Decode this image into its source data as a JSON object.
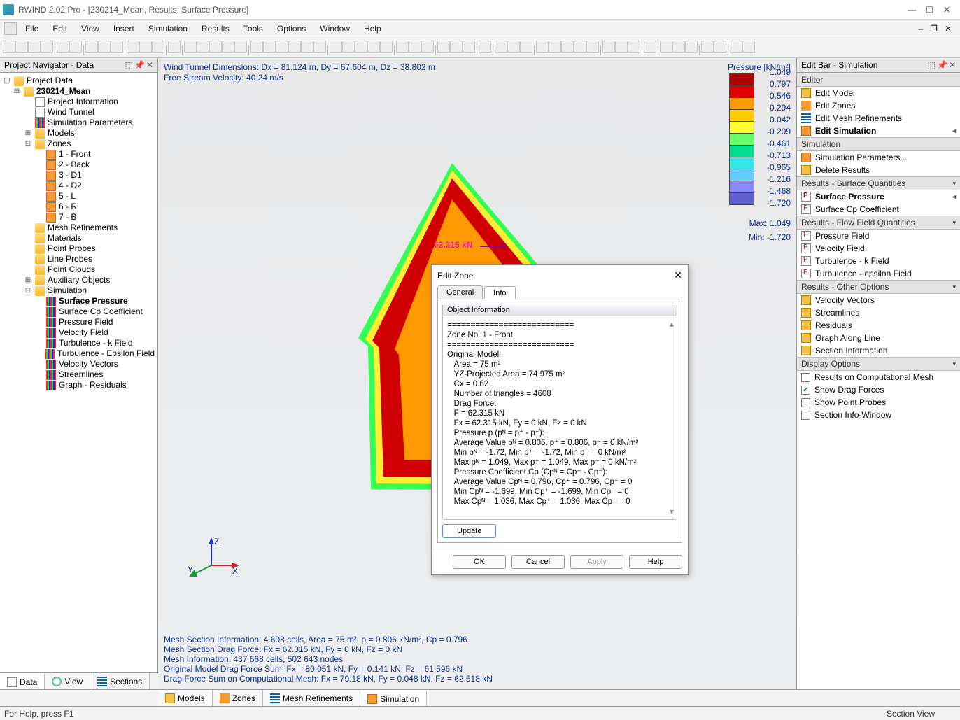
{
  "app": {
    "title": "RWIND 2.02 Pro - [230214_Mean, Results, Surface Pressure]"
  },
  "menu": [
    "File",
    "Edit",
    "View",
    "Insert",
    "Simulation",
    "Results",
    "Tools",
    "Options",
    "Window",
    "Help"
  ],
  "navigator": {
    "title": "Project Navigator - Data",
    "root": "Project Data",
    "project": "230214_Mean",
    "items": {
      "proj_info": "Project Information",
      "wind_tunnel": "Wind Tunnel",
      "sim_params": "Simulation Parameters",
      "models": "Models",
      "zones": "Zones",
      "zone_list": [
        "1 - Front",
        "2 - Back",
        "3 - D1",
        "4 - D2",
        "5 - L",
        "6 - R",
        "7 - B"
      ],
      "mesh_ref": "Mesh Refinements",
      "materials": "Materials",
      "point_probes": "Point Probes",
      "line_probes": "Line Probes",
      "point_clouds": "Point Clouds",
      "aux": "Auxiliary Objects",
      "simulation": "Simulation",
      "sim_list": [
        "Surface Pressure",
        "Surface Cp Coefficient",
        "Pressure Field",
        "Velocity Field",
        "Turbulence - k Field",
        "Turbulence - Epsilon Field",
        "Velocity Vectors",
        "Streamlines",
        "Graph - Residuals"
      ]
    }
  },
  "left_tabs": [
    "Data",
    "View",
    "Sections"
  ],
  "center_tabs": [
    "Models",
    "Zones",
    "Mesh Refinements",
    "Simulation"
  ],
  "viewport": {
    "dims": "Wind Tunnel Dimensions: Dx = 81.124 m, Dy = 67.604 m, Dz = 38.802 m",
    "vel": "Free Stream Velocity: 40.24 m/s",
    "force_label": "62.315 kN",
    "bottom": [
      "Mesh Section Information: 4 608 cells, Area = 75 m², p = 0.806 kN/m², Cp = 0.796",
      "Mesh Section Drag Force: Fx = 62.315 kN, Fy = 0 kN, Fz = 0 kN",
      "Mesh Information: 437 668 cells, 502 643 nodes",
      "Original Model Drag Force Sum: Fx = 80.051 kN, Fy = 0.141 kN, Fz = 61.596 kN",
      "Drag Force Sum on Computational Mesh: Fx = 79.18 kN, Fy = 0.048 kN, Fz = 62.518 kN"
    ]
  },
  "chart_data": {
    "type": "table",
    "title": "Pressure [kN/m²]",
    "categories": [
      "1.049",
      "0.797",
      "0.546",
      "0.294",
      "0.042",
      "-0.209",
      "-0.461",
      "-0.713",
      "-0.965",
      "-1.216",
      "-1.468",
      "-1.720"
    ],
    "colors": [
      "#b00000",
      "#e00000",
      "#ff9900",
      "#ffcc00",
      "#ffff33",
      "#66ff66",
      "#00e090",
      "#33e8e8",
      "#66ccff",
      "#8888ff",
      "#6060d0",
      "#2020c0"
    ],
    "max": "Max:   1.049",
    "min": "Min:  -1.720"
  },
  "dialog": {
    "title": "Edit Zone",
    "tabs": [
      "General",
      "Info"
    ],
    "group": "Object Information",
    "text": "===========================\nZone No. 1 - Front\n===========================\nOriginal Model:\n   Area = 75 m²\n   YZ-Projected Area = 74.975 m²\n   Cx = 0.62\n   Number of triangles = 4608\n   Drag Force:\n   F = 62.315 kN\n   Fx = 62.315 kN, Fy = 0 kN, Fz = 0 kN\n   Pressure p (pᴺ = p⁺ - p⁻):\n   Average Value pᴺ = 0.806, p⁺ = 0.806, p⁻ = 0 kN/m²\n   Min pᴺ = -1.72, Min p⁺ = -1.72, Min p⁻ = 0 kN/m²\n   Max pᴺ = 1.049, Max p⁺ = 1.049, Max p⁻ = 0 kN/m²\n   Pressure Coefficient Cp (Cpᴺ = Cp⁺ - Cp⁻):\n   Average Value Cpᴺ = 0.796, Cp⁺ = 0.796, Cp⁻ = 0\n   Min Cpᴺ = -1.699, Min Cp⁺ = -1.699, Min Cp⁻ = 0\n   Max Cpᴺ = 1.036, Max Cp⁺ = 1.036, Max Cp⁻ = 0",
    "update": "Update",
    "buttons": [
      "OK",
      "Cancel",
      "Apply",
      "Help"
    ]
  },
  "editbar": {
    "title": "Edit Bar - Simulation",
    "sections": [
      {
        "hdr": "Editor",
        "items": [
          {
            "label": "Edit Model",
            "icon": "ic-model"
          },
          {
            "label": "Edit Zones",
            "icon": "ic-zlist"
          },
          {
            "label": "Edit Mesh Refinements",
            "icon": "ic-mesh"
          },
          {
            "label": "Edit Simulation",
            "icon": "ic-sim",
            "bold": true,
            "arrow": true
          }
        ]
      },
      {
        "hdr": "Simulation",
        "items": [
          {
            "label": "Simulation Parameters...",
            "icon": "ic-sim"
          },
          {
            "label": "Delete Results",
            "icon": "ic-model"
          }
        ]
      },
      {
        "hdr": "Results - Surface Quantities",
        "arrow": true,
        "items": [
          {
            "label": "Surface Pressure",
            "icon": "ic-pr",
            "bold": true,
            "arrow": true
          },
          {
            "label": "Surface Cp Coefficient",
            "icon": "ic-pr"
          }
        ]
      },
      {
        "hdr": "Results - Flow Field Quantities",
        "arrow": true,
        "items": [
          {
            "label": "Pressure Field",
            "icon": "ic-pr"
          },
          {
            "label": "Velocity Field",
            "icon": "ic-pr"
          },
          {
            "label": "Turbulence - k Field",
            "icon": "ic-pr"
          },
          {
            "label": "Turbulence - epsilon Field",
            "icon": "ic-pr"
          }
        ]
      },
      {
        "hdr": "Results - Other Options",
        "arrow": true,
        "items": [
          {
            "label": "Velocity Vectors",
            "icon": "ic-model"
          },
          {
            "label": "Streamlines",
            "icon": "ic-model"
          },
          {
            "label": "Residuals",
            "icon": "ic-model"
          },
          {
            "label": "Graph Along Line",
            "icon": "ic-model"
          },
          {
            "label": "Section Information",
            "icon": "ic-model"
          }
        ]
      },
      {
        "hdr": "Display Options",
        "arrow": true,
        "checks": [
          {
            "label": "Results on Computational Mesh",
            "checked": false
          },
          {
            "label": "Show Drag Forces",
            "checked": true
          },
          {
            "label": "Show Point Probes",
            "checked": false
          },
          {
            "label": "Section Info-Window",
            "checked": false
          }
        ]
      }
    ]
  },
  "status": {
    "help": "For Help, press F1",
    "section": "Section View"
  }
}
